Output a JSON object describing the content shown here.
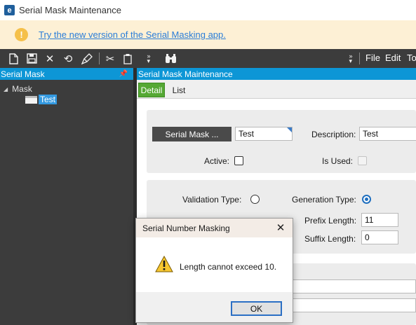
{
  "window": {
    "title": "Serial Mask Maintenance",
    "logo_letter": "e"
  },
  "banner": {
    "icon": "!",
    "link_text": "Try the new version of the Serial Masking app."
  },
  "toolbar": {
    "icons": [
      "new-icon",
      "save-icon",
      "delete-icon",
      "refresh-icon",
      "clear-icon",
      "cut-icon",
      "paste-icon",
      "overflow-icon",
      "search-icon"
    ],
    "menu": [
      "File",
      "Edit",
      "To"
    ]
  },
  "left_panel": {
    "title": "Serial Mask",
    "tree": {
      "root": "Mask",
      "child": "Test"
    }
  },
  "right_panel": {
    "title": "Serial Mask Maintenance",
    "tabs": [
      "Detail",
      "List"
    ],
    "form": {
      "serial_mask_button": "Serial Mask ...",
      "serial_mask_value": "Test",
      "description_label": "Description:",
      "description_value": "Test",
      "active_label": "Active:",
      "is_used_label": "Is Used:",
      "validation_type_label": "Validation Type:",
      "generation_type_label": "Generation Type:",
      "prefix_length_label": "Prefix Length:",
      "prefix_length_value": "11",
      "suffix_length_label": "Suffix Length:",
      "suffix_length_value": "0",
      "active": false,
      "is_used": false,
      "validation_type_selected": false,
      "generation_type_selected": true
    }
  },
  "dialog": {
    "title": "Serial Number Masking",
    "message": "Length cannot exceed 10.",
    "ok_label": "OK"
  }
}
